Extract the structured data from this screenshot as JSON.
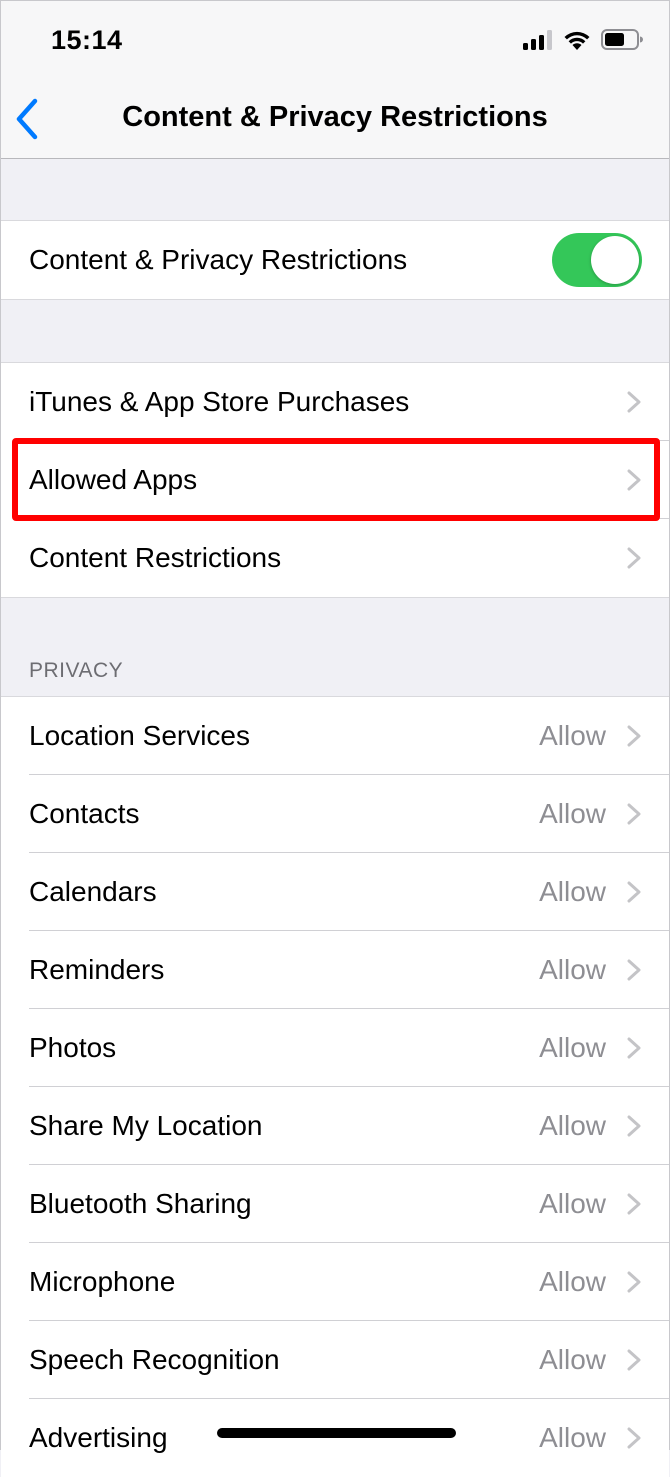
{
  "status_bar": {
    "time": "15:14",
    "icons": [
      "cellular-signal-icon",
      "wifi-icon",
      "battery-icon"
    ]
  },
  "nav": {
    "back_icon": "chevron-left-icon",
    "title": "Content & Privacy Restrictions"
  },
  "master": {
    "label": "Content & Privacy Restrictions",
    "enabled": true
  },
  "general": [
    {
      "label": "iTunes & App Store Purchases"
    },
    {
      "label": "Allowed Apps",
      "highlighted": true
    },
    {
      "label": "Content Restrictions"
    }
  ],
  "privacy": {
    "header": "PRIVACY",
    "items": [
      {
        "label": "Location Services",
        "value": "Allow"
      },
      {
        "label": "Contacts",
        "value": "Allow"
      },
      {
        "label": "Calendars",
        "value": "Allow"
      },
      {
        "label": "Reminders",
        "value": "Allow"
      },
      {
        "label": "Photos",
        "value": "Allow"
      },
      {
        "label": "Share My Location",
        "value": "Allow"
      },
      {
        "label": "Bluetooth Sharing",
        "value": "Allow"
      },
      {
        "label": "Microphone",
        "value": "Allow"
      },
      {
        "label": "Speech Recognition",
        "value": "Allow"
      },
      {
        "label": "Advertising",
        "value": "Allow"
      }
    ]
  },
  "colors": {
    "accent": "#007aff",
    "toggle_on": "#34c759",
    "highlight": "#ff0000"
  }
}
